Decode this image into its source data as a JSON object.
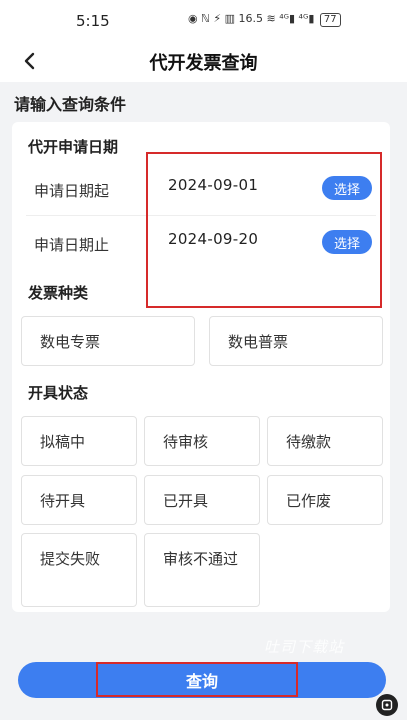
{
  "status_bar": {
    "time": "5:15",
    "icons_text": "◉ ℕ ⚡ ▥ 16.5 ≋ ⁴ᴳ▮ ⁴ᴳ▮",
    "battery": "77"
  },
  "nav": {
    "back_icon": "chevron-left-icon",
    "title": "代开发票查询"
  },
  "section_heading": "请输入查询条件",
  "date_group": {
    "title": "代开申请日期",
    "rows": [
      {
        "label": "申请日期起",
        "value": "2024-09-01",
        "button": "选择"
      },
      {
        "label": "申请日期止",
        "value": "2024-09-20",
        "button": "选择"
      }
    ]
  },
  "invoice_type": {
    "title": "发票种类",
    "options": [
      "数电专票",
      "数电普票"
    ]
  },
  "status_group": {
    "title": "开具状态",
    "options": [
      "拟稿中",
      "待审核",
      "待缴款",
      "待开具",
      "已开具",
      "已作废",
      "提交失败",
      "审核不通过"
    ]
  },
  "watermark": "吐司下载站",
  "query_button": "查询",
  "colors": {
    "accent": "#3d7ef0",
    "highlight": "#d62a2a",
    "background": "#f2f3f5"
  }
}
